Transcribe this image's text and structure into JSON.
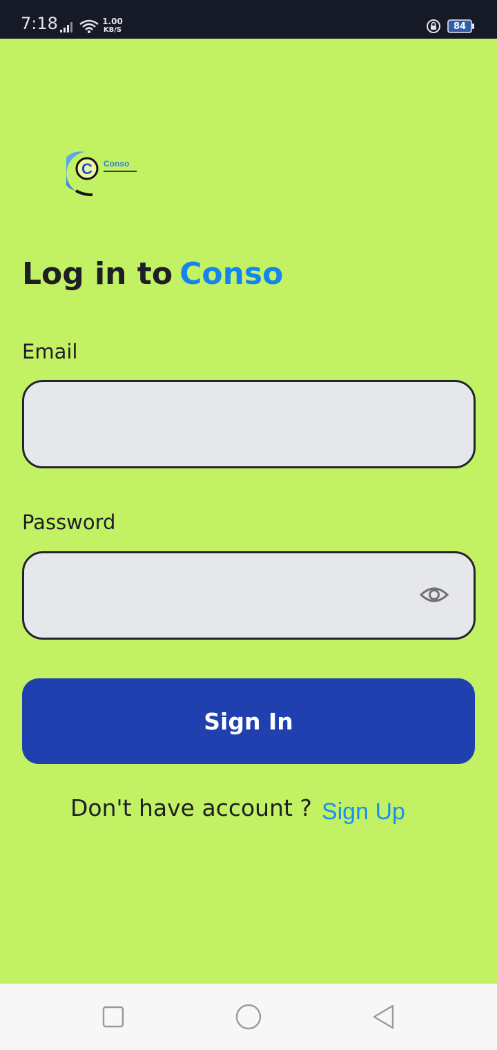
{
  "status_bar": {
    "time": "7:18",
    "network_speed_value": "1.00",
    "network_speed_unit": "KB/S",
    "battery_level": "84",
    "icons": [
      "signal-icon",
      "wifi-icon",
      "rotation-lock-icon",
      "battery-icon"
    ]
  },
  "logo": {
    "letter": "C",
    "brand_name": "Conso"
  },
  "heading": {
    "prefix": "Log in to",
    "brand": "Conso"
  },
  "form": {
    "email_label": "Email",
    "email_value": "",
    "password_label": "Password",
    "password_value": "",
    "password_toggle_icon": "eye-icon",
    "signin_label": "Sign In"
  },
  "signup": {
    "prompt": "Don't have account ?",
    "link": "Sign Up"
  },
  "nav_bar": {
    "icons": [
      "recents-icon",
      "home-icon",
      "back-icon"
    ]
  },
  "colors": {
    "background": "#c2f264",
    "brand_blue": "#1584ee",
    "button": "#2040b0",
    "field_bg": "#e6e7ea",
    "status_bar": "#161a26"
  }
}
